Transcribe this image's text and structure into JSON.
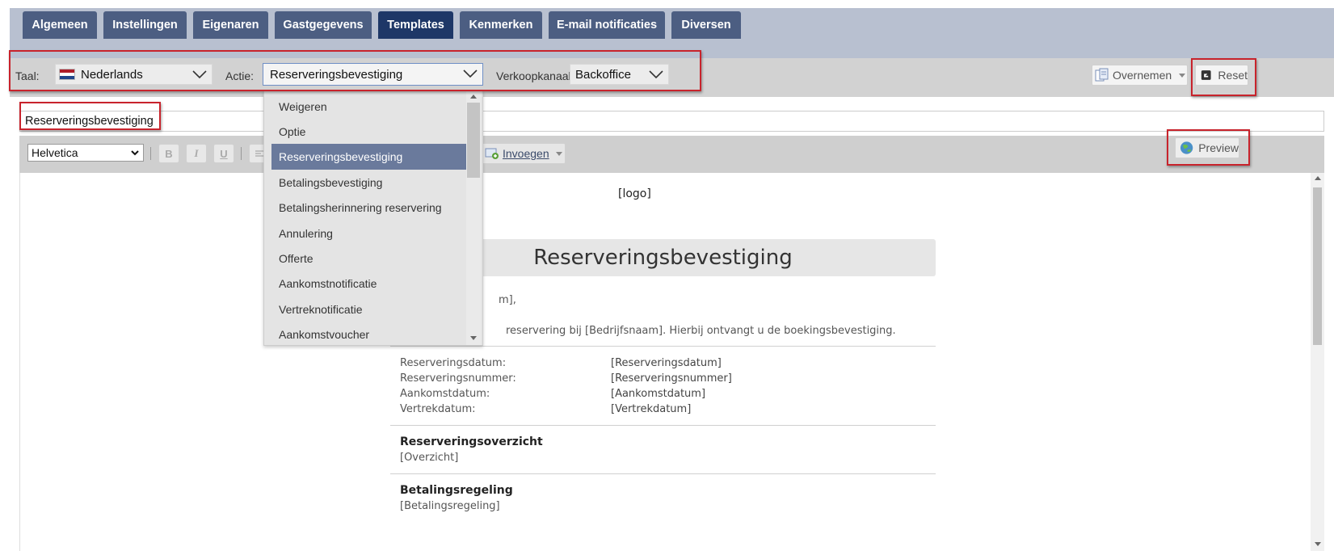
{
  "tabs": [
    {
      "label": "Algemeen",
      "active": false
    },
    {
      "label": "Instellingen",
      "active": false
    },
    {
      "label": "Eigenaren",
      "active": false
    },
    {
      "label": "Gastgegevens",
      "active": false
    },
    {
      "label": "Templates",
      "active": true
    },
    {
      "label": "Kenmerken",
      "active": false
    },
    {
      "label": "E-mail notificaties",
      "active": false
    },
    {
      "label": "Diversen",
      "active": false
    }
  ],
  "filters": {
    "language_label": "Taal:",
    "language_value": "Nederlands",
    "action_label": "Actie:",
    "action_value": "Reserveringsbevestiging",
    "channel_label": "Verkoopkanaal:",
    "channel_value": "Backoffice",
    "copy_button": "Overnemen",
    "reset_button": "Reset"
  },
  "subject_value": "Reserveringsbevestiging",
  "editor_toolbar": {
    "font": "Helvetica",
    "bold": "B",
    "italic": "I",
    "underline": "U",
    "insert_button": "Invoegen",
    "preview_button": "Preview"
  },
  "dropdown": {
    "items": [
      {
        "label": "Weigeren",
        "selected": false
      },
      {
        "label": "Optie",
        "selected": false
      },
      {
        "label": "Reserveringsbevestiging",
        "selected": true
      },
      {
        "label": "Betalingsbevestiging",
        "selected": false
      },
      {
        "label": "Betalingsherinnering reservering",
        "selected": false
      },
      {
        "label": "Annulering",
        "selected": false
      },
      {
        "label": "Offerte",
        "selected": false
      },
      {
        "label": "Aankomstnotificatie",
        "selected": false
      },
      {
        "label": "Vertreknotificatie",
        "selected": false
      },
      {
        "label": "Aankomstvoucher",
        "selected": false
      }
    ]
  },
  "document": {
    "logo": "[logo]",
    "title": "Reserveringsbevestiging",
    "greeting_fragment": "m],",
    "intro_fragment": "reservering bij [Bedrijfsnaam]. Hierbij ontvangt u de boekingsbevestiging.",
    "details": [
      {
        "key": "Reserveringsdatum:",
        "value": "[Reserveringsdatum]"
      },
      {
        "key": "Reserveringsnummer:",
        "value": "[Reserveringsnummer]"
      },
      {
        "key": "Aankomstdatum:",
        "value": "[Aankomstdatum]"
      },
      {
        "key": "Vertrekdatum:",
        "value": "[Vertrekdatum]"
      }
    ],
    "overview_title": "Reserveringsoverzicht",
    "overview_value": "[Overzicht]",
    "payment_title": "Betalingsregeling",
    "payment_value": "[Betalingsregeling]"
  },
  "colors": {
    "tab": "#4c5e82",
    "tab_active": "#1e3767",
    "highlight_box": "#c8232c",
    "dropdown_selected": "#6a7a9c"
  }
}
